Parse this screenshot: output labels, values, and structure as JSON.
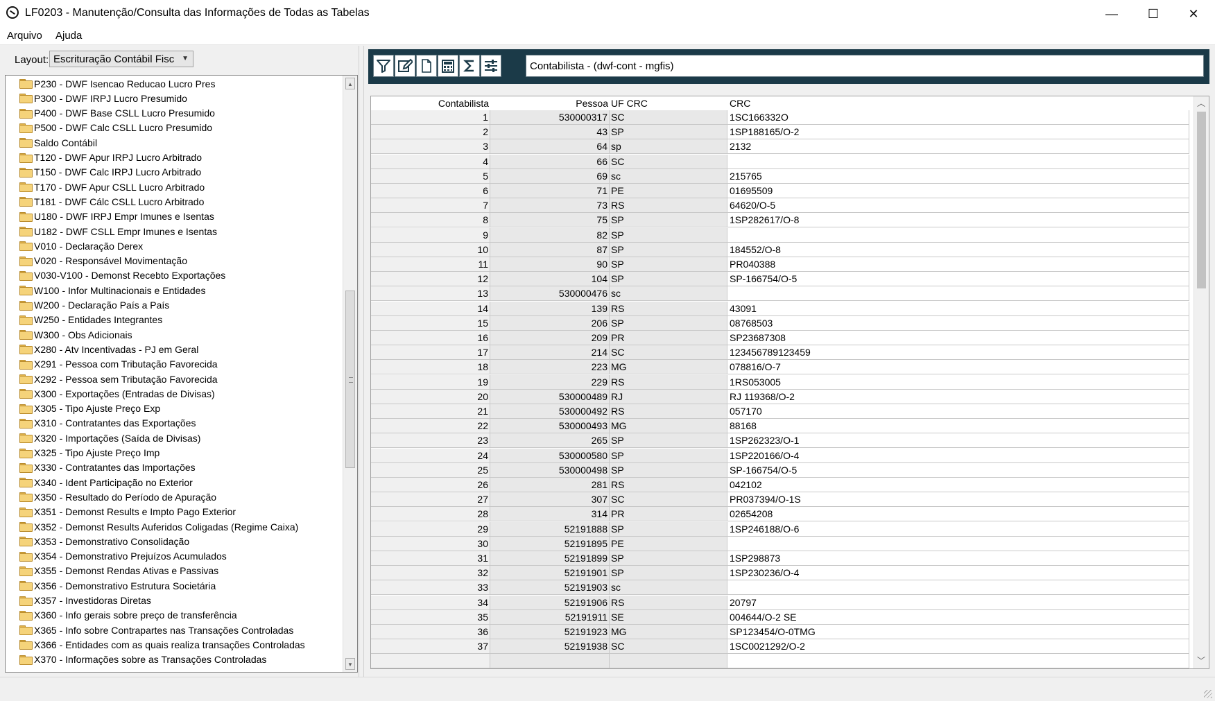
{
  "window": {
    "title": "LF0203 - Manutenção/Consulta das Informações de Todas as Tabelas",
    "minimize_glyph": "—",
    "maximize_glyph": "☐",
    "close_glyph": "✕"
  },
  "menu": {
    "file": "Arquivo",
    "help": "Ajuda"
  },
  "layout": {
    "label": "Layout:",
    "value": "Escrituração Contábil Fisc"
  },
  "tree": {
    "items": [
      "P230 - DWF Isencao Reducao Lucro Pres",
      "P300 - DWF IRPJ Lucro Presumido",
      "P400 - DWF Base CSLL Lucro Presumido",
      "P500 - DWF Calc CSLL Lucro Presumido",
      "Saldo Contábil",
      "T120 - DWF Apur IRPJ Lucro Arbitrado",
      "T150 - DWF Calc IRPJ Lucro Arbitrado",
      "T170 - DWF Apur CSLL Lucro Arbitrado",
      "T181 - DWF Cálc CSLL Lucro Arbitrado",
      "U180 - DWF IRPJ Empr Imunes e Isentas",
      "U182 - DWF CSLL Empr Imunes e Isentas",
      "V010 - Declaração Derex",
      "V020 - Responsável Movimentação",
      "V030-V100 - Demonst Recebto Exportações",
      "W100 - Infor Multinacionais e Entidades",
      "W200 - Declaração País a País",
      "W250 - Entidades Integrantes",
      "W300 - Obs Adicionais",
      "X280 - Atv Incentivadas - PJ em Geral",
      "X291 - Pessoa com Tributação Favorecida",
      "X292 - Pessoa sem Tributação Favorecida",
      "X300 - Exportações (Entradas de Divisas)",
      "X305 - Tipo Ajuste Preço Exp",
      "X310 - Contratantes das Exportações",
      "X320 - Importações (Saída de Divisas)",
      "X325 - Tipo Ajuste Preço Imp",
      "X330 - Contratantes das Importações",
      "X340 - Ident Participação no Exterior",
      "X350 - Resultado do Período de Apuração",
      "X351 - Demonst Results e Impto Pago Exterior",
      "X352 - Demonst Results Auferidos Coligadas (Regime Caixa)",
      "X353 - Demonstrativo Consolidação",
      "X354 - Demonstrativo Prejuízos Acumulados",
      "X355 - Demonst Rendas Ativas e Passivas",
      "X356 - Demonstrativo Estrutura Societária",
      "X357 - Investidoras Diretas",
      "X360 - Info gerais sobre preço de transferência",
      "X365 - Info sobre Contrapartes nas Transações Controladas",
      "X366 - Entidades com as quais realiza transações Controladas",
      "X370 - Informações sobre as Transações Controladas"
    ]
  },
  "toolbar": {
    "icons": [
      "filter-icon",
      "edit-icon",
      "new-document-icon",
      "calculator-icon",
      "sum-icon",
      "settings-sliders-icon"
    ],
    "table_name": "Contabilista - (dwf-cont - mgfis)"
  },
  "grid": {
    "headers": {
      "num": "Contabilista",
      "pessoa": "Pessoa",
      "uf": "UF CRC",
      "crc": "CRC"
    },
    "rows": [
      [
        "1",
        "530000317",
        "SC",
        "1SC166332O"
      ],
      [
        "2",
        "43",
        "SP",
        "1SP188165/O-2"
      ],
      [
        "3",
        "64",
        "sp",
        "2132"
      ],
      [
        "4",
        "66",
        "SC",
        ""
      ],
      [
        "5",
        "69",
        "sc",
        "215765"
      ],
      [
        "6",
        "71",
        "PE",
        "01695509"
      ],
      [
        "7",
        "73",
        "RS",
        "64620/O-5"
      ],
      [
        "8",
        "75",
        "SP",
        "1SP282617/O-8"
      ],
      [
        "9",
        "82",
        "SP",
        ""
      ],
      [
        "10",
        "87",
        "SP",
        "184552/O-8"
      ],
      [
        "11",
        "90",
        "SP",
        "PR040388"
      ],
      [
        "12",
        "104",
        "SP",
        "SP-166754/O-5"
      ],
      [
        "13",
        "530000476",
        "sc",
        ""
      ],
      [
        "14",
        "139",
        "RS",
        "43091"
      ],
      [
        "15",
        "206",
        "SP",
        "08768503"
      ],
      [
        "16",
        "209",
        "PR",
        "SP23687308"
      ],
      [
        "17",
        "214",
        "SC",
        "123456789123459"
      ],
      [
        "18",
        "223",
        "MG",
        "078816/O-7"
      ],
      [
        "19",
        "229",
        "RS",
        "1RS053005"
      ],
      [
        "20",
        "530000489",
        "RJ",
        "RJ 119368/O-2"
      ],
      [
        "21",
        "530000492",
        "RS",
        "057170"
      ],
      [
        "22",
        "530000493",
        "MG",
        "88168"
      ],
      [
        "23",
        "265",
        "SP",
        "1SP262323/O-1"
      ],
      [
        "24",
        "530000580",
        "SP",
        "1SP220166/O-4"
      ],
      [
        "25",
        "530000498",
        "SP",
        "SP-166754/O-5"
      ],
      [
        "26",
        "281",
        "RS",
        "042102"
      ],
      [
        "27",
        "307",
        "SC",
        "PR037394/O-1S"
      ],
      [
        "28",
        "314",
        "PR",
        "02654208"
      ],
      [
        "29",
        "52191888",
        "SP",
        "1SP246188/O-6"
      ],
      [
        "30",
        "52191895",
        "PE",
        ""
      ],
      [
        "31",
        "52191899",
        "SP",
        "1SP298873"
      ],
      [
        "32",
        "52191901",
        "SP",
        "1SP230236/O-4"
      ],
      [
        "33",
        "52191903",
        "sc",
        ""
      ],
      [
        "34",
        "52191906",
        "RS",
        "20797"
      ],
      [
        "35",
        "52191911",
        "SE",
        "004644/O-2 SE"
      ],
      [
        "36",
        "52191923",
        "MG",
        "SP123454/O-0TMG"
      ],
      [
        "37",
        "52191938",
        "SC",
        "1SC0021292/O-2"
      ]
    ]
  },
  "colors": {
    "toolbar_bg": "#1b3a48",
    "folder": "#f5d37a"
  }
}
